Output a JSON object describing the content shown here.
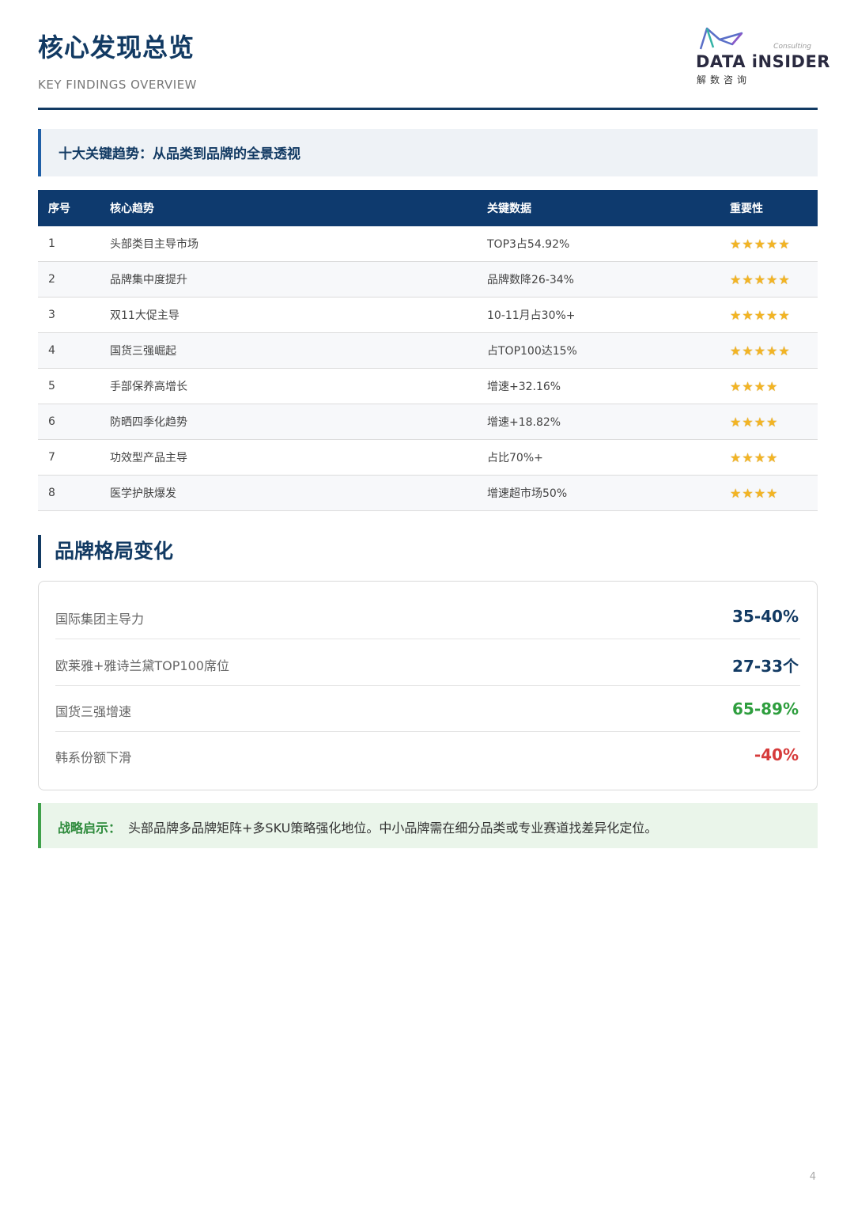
{
  "header": {
    "title": "核心发现总览",
    "subtitle": "KEY FINDINGS OVERVIEW",
    "logo": {
      "small_text": "Consulting",
      "brand": "DATA iNSIDER",
      "cn": "解数咨询"
    }
  },
  "banner": {
    "text": "十大关键趋势：从品类到品牌的全景透视"
  },
  "trends_table": {
    "headers": [
      "序号",
      "核心趋势",
      "关键数据",
      "重要性"
    ],
    "rows": [
      {
        "no": "1",
        "trend": "头部类目主导市场",
        "data": "TOP3占54.92%",
        "importance": 5
      },
      {
        "no": "2",
        "trend": "品牌集中度提升",
        "data": "品牌数降26-34%",
        "importance": 5
      },
      {
        "no": "3",
        "trend": "双11大促主导",
        "data": "10-11月占30%+",
        "importance": 5
      },
      {
        "no": "4",
        "trend": "国货三强崛起",
        "data": "占TOP100达15%",
        "importance": 5
      },
      {
        "no": "5",
        "trend": "手部保养高增长",
        "data": "增速+32.16%",
        "importance": 4
      },
      {
        "no": "6",
        "trend": "防晒四季化趋势",
        "data": "增速+18.82%",
        "importance": 4
      },
      {
        "no": "7",
        "trend": "功效型产品主导",
        "data": "占比70%+",
        "importance": 4
      },
      {
        "no": "8",
        "trend": "医学护肤爆发",
        "data": "增速超市场50%",
        "importance": 4
      }
    ]
  },
  "brand_section": {
    "title": "品牌格局变化",
    "items": [
      {
        "label": "国际集团主导力",
        "value": "35-40%",
        "color": "#123a63"
      },
      {
        "label": "欧莱雅+雅诗兰黛TOP100席位",
        "value": "27-33个",
        "color": "#123a63"
      },
      {
        "label": "国货三强增速",
        "value": "65-89%",
        "color": "#2e9e3e"
      },
      {
        "label": "韩系份额下滑",
        "value": "-40%",
        "color": "#d63b3b"
      }
    ]
  },
  "insight": {
    "lead": "战略启示：",
    "text": "头部品牌多品牌矩阵+多SKU策略强化地位。中小品牌需在细分品类或专业赛道找差异化定位。"
  },
  "page_number": "4"
}
